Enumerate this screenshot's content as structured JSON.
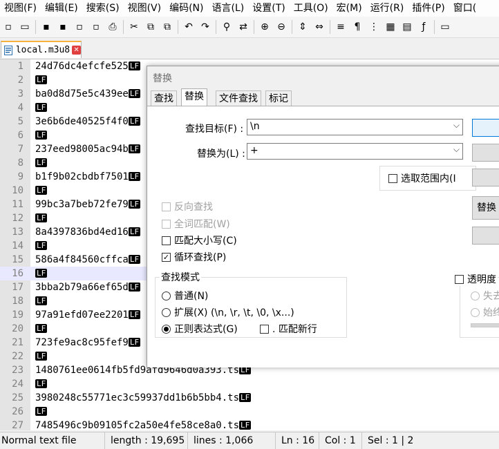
{
  "menu": [
    "视图(F)",
    "编辑(E)",
    "搜索(S)",
    "视图(V)",
    "编码(N)",
    "语言(L)",
    "设置(T)",
    "工具(O)",
    "宏(M)",
    "运行(R)",
    "插件(P)",
    "窗口("
  ],
  "toolbar": {
    "icons": [
      "new-file-icon",
      "open-file-icon",
      "save-icon",
      "save-all-icon",
      "close-icon",
      "close-all-icon",
      "print-icon",
      "cut-icon",
      "copy-icon",
      "paste-icon",
      "undo-icon",
      "redo-icon",
      "find-icon",
      "replace-icon",
      "zoom-in-icon",
      "zoom-out-icon",
      "sync-vertical-icon",
      "sync-horizontal-icon",
      "word-wrap-icon",
      "show-all-chars-icon",
      "indent-guide-icon",
      "doc-map-icon",
      "function-list-icon",
      "folder-workspace-icon",
      "monitoring-icon"
    ],
    "glyphs": [
      "▫",
      "▭",
      "▪",
      "▪",
      "▫",
      "▫",
      "⎙",
      "✂",
      "⧉",
      "⧉",
      "↶",
      "↷",
      "⚲",
      "⇄",
      "⊕",
      "⊖",
      "⇕",
      "⇔",
      "≡",
      "¶",
      "⋮",
      "▦",
      "▤",
      "ƒ",
      "▭"
    ]
  },
  "tab": {
    "label": "local.m3u8",
    "close": "✕"
  },
  "editor": {
    "lf_marker": "LF",
    "current_line": 16,
    "lines": [
      {
        "n": "1",
        "text": "24d76dc4efcfe525"
      },
      {
        "n": "2",
        "text": ""
      },
      {
        "n": "3",
        "text": "ba0d8d75e5c439ee"
      },
      {
        "n": "4",
        "text": ""
      },
      {
        "n": "5",
        "text": "3e6b6de40525f4f0"
      },
      {
        "n": "6",
        "text": ""
      },
      {
        "n": "7",
        "text": "237eed98005ac94b"
      },
      {
        "n": "8",
        "text": ""
      },
      {
        "n": "9",
        "text": "b1f9b02cbdbf7501"
      },
      {
        "n": "10",
        "text": ""
      },
      {
        "n": "11",
        "text": "99bc3a7beb72fe79"
      },
      {
        "n": "12",
        "text": ""
      },
      {
        "n": "13",
        "text": "8a4397836bd4ed16"
      },
      {
        "n": "14",
        "text": ""
      },
      {
        "n": "15",
        "text": "586a4f84560cffca"
      },
      {
        "n": "16",
        "text": ""
      },
      {
        "n": "17",
        "text": "3bba2b79a66ef65d"
      },
      {
        "n": "18",
        "text": ""
      },
      {
        "n": "19",
        "text": "97a91efd07ee2201"
      },
      {
        "n": "20",
        "text": ""
      },
      {
        "n": "21",
        "text": "723fe9ac8c95fef9"
      },
      {
        "n": "22",
        "text": ""
      },
      {
        "n": "23",
        "text": "1480761ee0614fb5fd9afd9646d0a393.ts"
      },
      {
        "n": "24",
        "text": ""
      },
      {
        "n": "25",
        "text": "3980248c55771ec3c59937dd1b6b5bb4.ts"
      },
      {
        "n": "26",
        "text": ""
      },
      {
        "n": "27",
        "text": "7485496c9b09105fc2a50e4fe58ce8a0.ts"
      }
    ]
  },
  "dialog": {
    "title": "替换",
    "tabs": [
      "查找",
      "替换",
      "文件查找",
      "标记"
    ],
    "find_label": "查找目标(F) :",
    "find_value": "\\n",
    "replace_label": "替换为(L) :",
    "replace_value": "+",
    "combo_arrow": "⌵",
    "in_selection": "选取范围内(I",
    "replace_btn": "替换",
    "backward": "反向查找",
    "whole_word": "全词匹配(W)",
    "match_case": "匹配大小写(C)",
    "wrap_around": "循环查找(P)",
    "check_mark": "✓",
    "search_mode_label": "查找模式",
    "mode_normal": "普通(N)",
    "mode_extended": "扩展(X) (\\n, \\r, \\t, \\0, \\x...)",
    "mode_regex": "正则表达式(G)",
    "dot_newline": ". 匹配新行",
    "transparency": "透明度",
    "on_lose_focus": "失去",
    "always": "始终"
  },
  "status": {
    "file_type": "Normal text file",
    "length": "length : 19,695",
    "lines": "lines : 1,066",
    "ln": "Ln : 16",
    "col": "Col : 1",
    "sel": "Sel : 1 | 2"
  }
}
